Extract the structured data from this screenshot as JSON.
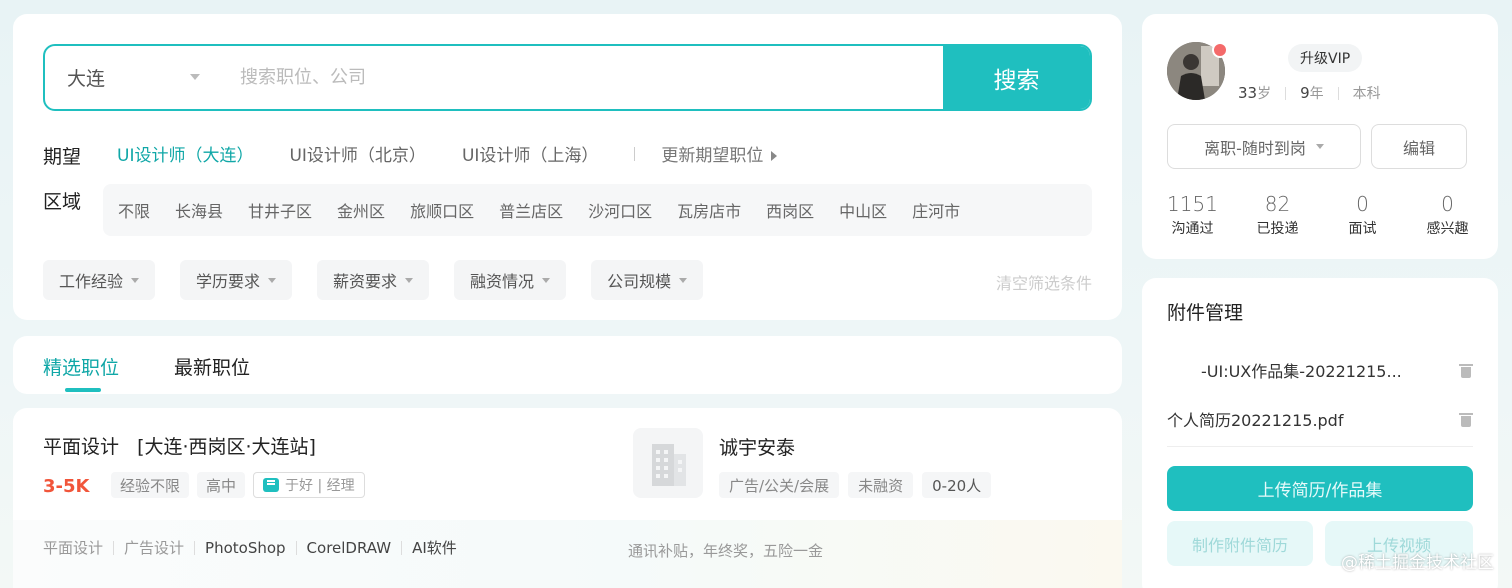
{
  "search": {
    "city": "大连",
    "placeholder": "搜索职位、公司",
    "button": "搜索"
  },
  "expect": {
    "label": "期望",
    "options": [
      "UI设计师（大连）",
      "UI设计师（北京）",
      "UI设计师（上海）"
    ],
    "more": "更新期望职位"
  },
  "area": {
    "label": "区域",
    "items": [
      "不限",
      "长海县",
      "甘井子区",
      "金州区",
      "旅顺口区",
      "普兰店区",
      "沙河口区",
      "瓦房店市",
      "西岗区",
      "中山区",
      "庄河市"
    ]
  },
  "filters": [
    "工作经验",
    "学历要求",
    "薪资要求",
    "融资情况",
    "公司规模"
  ],
  "clear_filters": "清空筛选条件",
  "tabs": [
    "精选职位",
    "最新职位"
  ],
  "job": {
    "title": "平面设计",
    "location": "[大连·西岗区·大连站]",
    "salary": "3-5K",
    "tags": [
      "经验不限",
      "高中"
    ],
    "recruiter": "于好 | 经理",
    "company": "诚宇安泰",
    "company_tags": [
      "广告/公关/会展",
      "未融资",
      "0-20人"
    ],
    "skills": [
      "平面设计",
      "广告设计",
      "PhotoShop",
      "CorelDRAW",
      "AI软件"
    ],
    "benefits": "通讯补贴，年终奖，五险一金"
  },
  "profile": {
    "vip": "升级VIP",
    "age_num": "33",
    "age_unit": "岁",
    "exp_num": "9",
    "exp_unit": "年",
    "education": "本科",
    "status": "离职-随时到岗",
    "edit": "编辑",
    "stats": [
      {
        "num": "1151",
        "label": "沟通过"
      },
      {
        "num": "82",
        "label": "已投递"
      },
      {
        "num": "0",
        "label": "面试"
      },
      {
        "num": "0",
        "label": "感兴趣"
      }
    ]
  },
  "attachments": {
    "title": "附件管理",
    "files": [
      "-UI:UX作品集-20221215...",
      "个人简历20221215.pdf"
    ],
    "upload": "上传简历/作品集",
    "make": "制作附件简历",
    "video": "上传视频"
  },
  "watermark": "@稀土掘金技术社区",
  "colors": {
    "accent": "#1fbfbf",
    "salary": "#f1553a"
  }
}
